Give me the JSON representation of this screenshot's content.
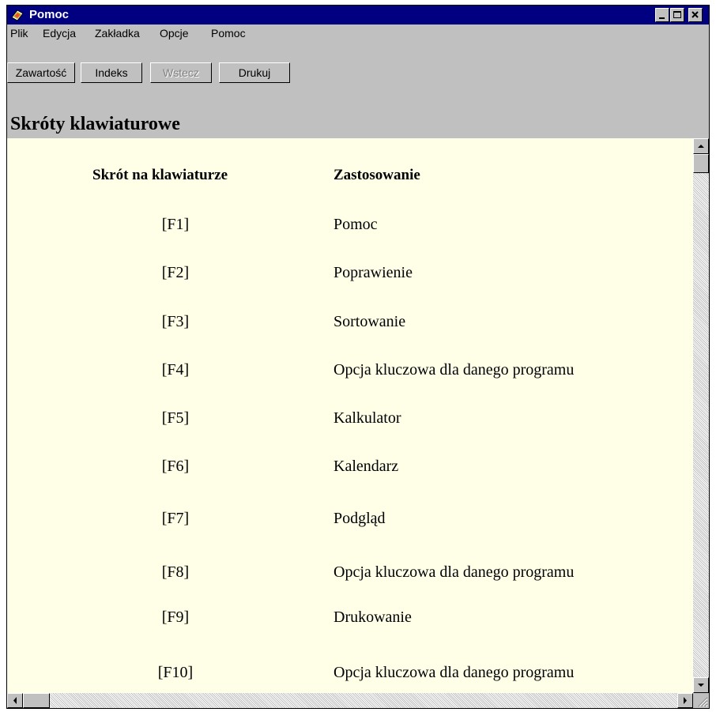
{
  "window": {
    "title": "Pomoc",
    "icon": "help-book-icon",
    "controls": {
      "minimize": "_",
      "maximize": "□",
      "close": "×"
    }
  },
  "menu": {
    "items": [
      {
        "label": "Plik"
      },
      {
        "label": "Edycja"
      },
      {
        "label": "Zakładka"
      },
      {
        "label": "Opcje"
      },
      {
        "label": "Pomoc"
      }
    ]
  },
  "toolbar": {
    "buttons": [
      {
        "label": "Zawartość",
        "enabled": true
      },
      {
        "label": "Indeks",
        "enabled": true
      },
      {
        "label": "Wstecz",
        "enabled": false
      },
      {
        "label": "Drukuj",
        "enabled": true
      }
    ]
  },
  "topic": {
    "title": "Skróty klawiaturowe"
  },
  "table": {
    "headers": [
      "Skrót na klawiaturze",
      "Zastosowanie"
    ],
    "rows": [
      {
        "key": "[F1]",
        "use": "Pomoc"
      },
      {
        "key": "[F2]",
        "use": "Poprawienie"
      },
      {
        "key": "[F3]",
        "use": "Sortowanie"
      },
      {
        "key": "[F4]",
        "use": "Opcja kluczowa dla danego programu"
      },
      {
        "key": "[F5]",
        "use": "Kalkulator"
      },
      {
        "key": "[F6]",
        "use": "Kalendarz"
      },
      {
        "key": "[F7]",
        "use": "Podgląd"
      },
      {
        "key": "[F8]",
        "use": "Opcja kluczowa dla danego programu"
      },
      {
        "key": "[F9]",
        "use": "Drukowanie"
      },
      {
        "key": "[F10]",
        "use": "Opcja kluczowa dla danego programu"
      }
    ]
  },
  "colors": {
    "titlebar": "#000080",
    "chrome": "#c0c0c0",
    "content_background": "#ffffe8"
  }
}
